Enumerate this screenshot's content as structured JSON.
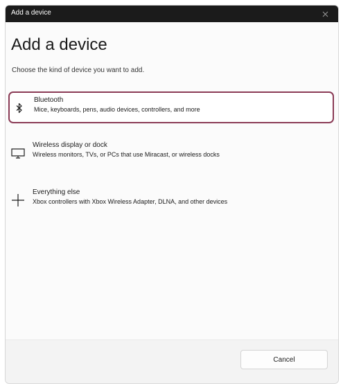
{
  "window": {
    "title": "Add a device"
  },
  "dialog": {
    "heading": "Add a device",
    "subtitle": "Choose the kind of device you want to add."
  },
  "options": [
    {
      "title": "Bluetooth",
      "description": "Mice, keyboards, pens, audio devices, controllers, and more",
      "icon": "bluetooth-icon",
      "selected": true
    },
    {
      "title": "Wireless display or dock",
      "description": "Wireless monitors, TVs, or PCs that use Miracast, or wireless docks",
      "icon": "monitor-icon",
      "selected": false
    },
    {
      "title": "Everything else",
      "description": "Xbox controllers with Xbox Wireless Adapter, DLNA, and other devices",
      "icon": "plus-icon",
      "selected": false
    }
  ],
  "footer": {
    "cancel_label": "Cancel"
  },
  "colors": {
    "titlebar": "#1b1b1b",
    "selection_border": "#8a3a55",
    "background": "#fbfbfb",
    "footer": "#f3f3f3"
  }
}
